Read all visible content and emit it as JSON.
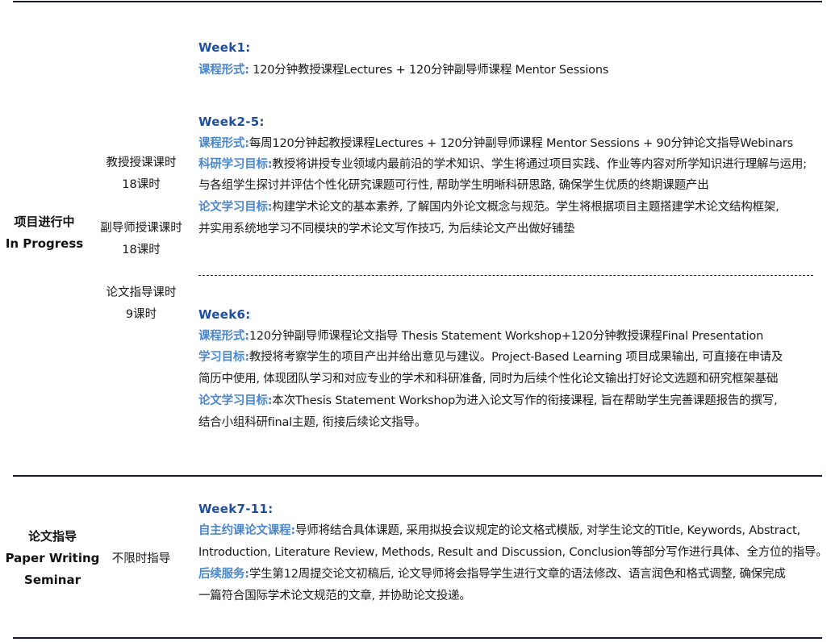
{
  "accent_colors": {
    "week_heading": "#1f4f9a",
    "label": "#4a87cf",
    "rule": "#141a33"
  },
  "sections": [
    {
      "phase_cn": "项目进行中",
      "phase_en": "In Progress",
      "hours": [
        {
          "label": "教授授课课时",
          "value": "18课时"
        },
        {
          "label": "副导师授课课时",
          "value": "18课时"
        },
        {
          "label": "论文指导课时",
          "value": "9课时"
        }
      ],
      "weeks": [
        {
          "title": "Week1:",
          "lines": [
            {
              "label": "课程形式:",
              "text": " 120分钟教授课程Lectures + 120分钟副导师课程   Mentor Sessions"
            }
          ]
        },
        {
          "title": "Week2-5:",
          "lines": [
            {
              "label": "课程形式:",
              "text": "每周120分钟起教授课程Lectures + 120分钟副导师课程   Mentor Sessions + 90分钟论文指导Webinars"
            },
            {
              "label": "科研学习目标:",
              "text": "教授将讲授专业领域内最前沿的学术知识、学生将通过项目实践、作业等内容对所学知识进行理解与运用;"
            },
            {
              "label": "",
              "text": "与各组学生探讨并评估个性化研究课题可行性, 帮助学生明晰科研思路, 确保学生优质的终期课题产出"
            },
            {
              "label": "论文学习目标:",
              "text": "构建学术论文的基本素养, 了解国内外论文概念与规范。学生将根据项目主题搭建学术论文结构框架,"
            },
            {
              "label": "",
              "text": "并实用系统地学习不同模块的学术论文写作技巧, 为后续论文产出做好铺垫"
            }
          ]
        },
        {
          "title": "Week6:",
          "lines": [
            {
              "label": "课程形式:",
              "text": "120分钟副导师课程论文指导  Thesis Statement Workshop+120分钟教授课程Final Presentation"
            },
            {
              "label": "学习目标:",
              "text": "教授将考察学生的项目产出并给出意见与建议。Project-Based Learning 项目成果输出, 可直接在申请及"
            },
            {
              "label": "",
              "text": "简历中使用, 体现团队学习和对应专业的学术和科研准备, 同时为后续个性化论文输出打好论文选题和研究框架基础"
            },
            {
              "label": "论文学习目标:",
              "text": "本次Thesis Statement Workshop为进入论文写作的衔接课程, 旨在帮助学生完善课题报告的撰写,"
            },
            {
              "label": "",
              "text": "结合小组科研final主题, 衔接后续论文指导。"
            }
          ]
        }
      ]
    },
    {
      "phase_cn": "论文指导",
      "phase_en_1": "Paper Writing",
      "phase_en_2": "Seminar",
      "hours_text": "不限时指导",
      "weeks": [
        {
          "title": "Week7-11:",
          "lines": [
            {
              "label": "自主约课论文课程:",
              "text": "导师将结合具体课题, 采用拟投会议规定的论文格式模版, 对学生论文的Title, Keywords, Abstract,"
            },
            {
              "label": "",
              "text": "Introduction, Literature Review, Methods, Result and Discussion, Conclusion等部分写作进行具体、全方位的指导。"
            },
            {
              "label": "后续服务:",
              "text": "学生第12周提交论文初稿后, 论文导师将会指导学生进行文章的语法修改、语言润色和格式调整, 确保完成"
            },
            {
              "label": "",
              "text": "一篇符合国际学术论文规范的文章, 并协助论文投递。"
            }
          ]
        }
      ]
    }
  ]
}
